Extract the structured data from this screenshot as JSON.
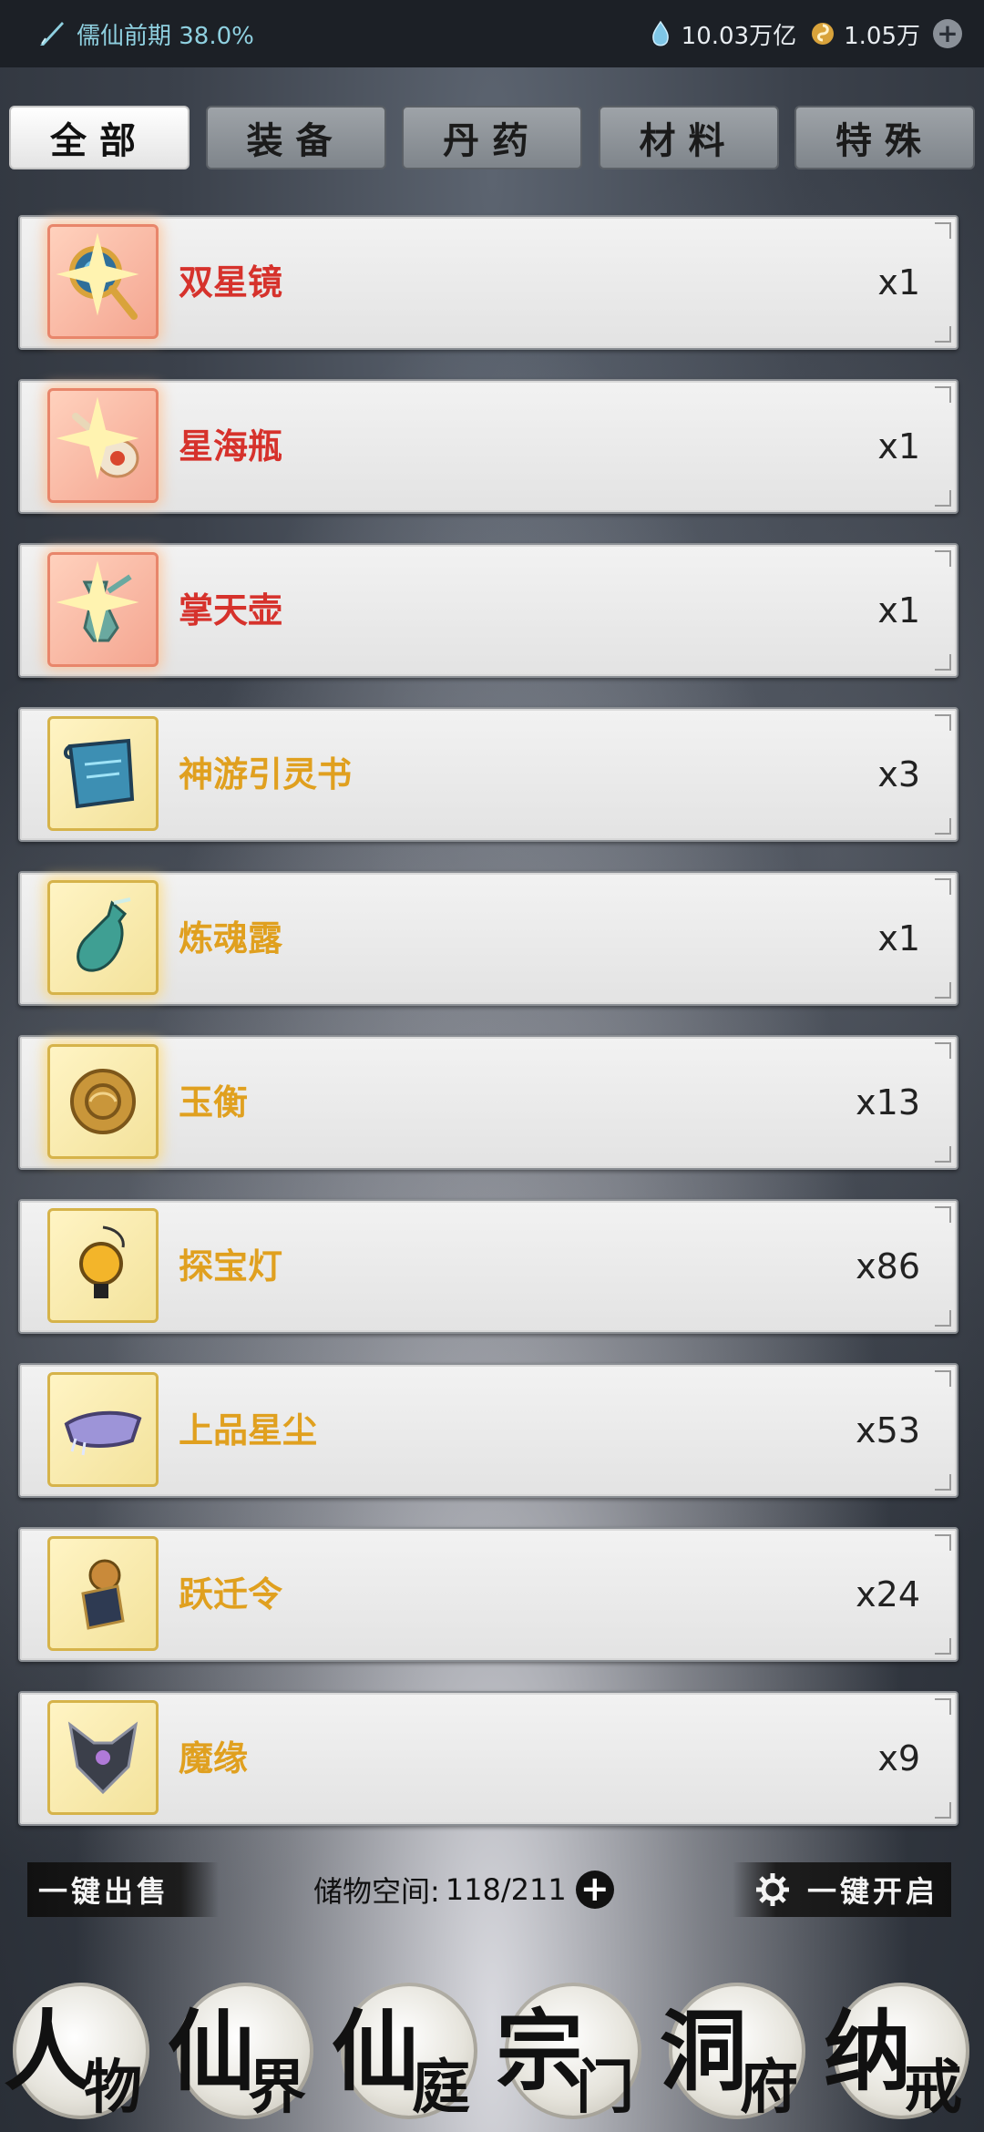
{
  "status": {
    "realm_label": "儒仙前期 38.0%",
    "spirit_stones": "10.03万亿",
    "currency2": "1.05万"
  },
  "tabs": [
    {
      "label": "全部",
      "active": true
    },
    {
      "label": "装备",
      "active": false
    },
    {
      "label": "丹药",
      "active": false
    },
    {
      "label": "材料",
      "active": false
    },
    {
      "label": "特殊",
      "active": false
    }
  ],
  "items": [
    {
      "name": "双星镜",
      "count": "x1",
      "rarity": "red",
      "icon": "mirror-icon"
    },
    {
      "name": "星海瓶",
      "count": "x1",
      "rarity": "red",
      "icon": "gourd-icon"
    },
    {
      "name": "掌天壶",
      "count": "x1",
      "rarity": "red",
      "icon": "vase-icon"
    },
    {
      "name": "神游引灵书",
      "count": "x3",
      "rarity": "gold",
      "icon": "scroll-icon"
    },
    {
      "name": "炼魂露",
      "count": "x1",
      "rarity": "gold",
      "icon": "bottle-icon"
    },
    {
      "name": "玉衡",
      "count": "x13",
      "rarity": "gold",
      "icon": "jade-disc-icon"
    },
    {
      "name": "探宝灯",
      "count": "x86",
      "rarity": "gold",
      "icon": "lantern-icon"
    },
    {
      "name": "上品星尘",
      "count": "x53",
      "rarity": "gold",
      "icon": "stardust-icon"
    },
    {
      "name": "跃迁令",
      "count": "x24",
      "rarity": "gold",
      "icon": "token-icon"
    },
    {
      "name": "魔缘",
      "count": "x9",
      "rarity": "gold",
      "icon": "demon-crest-icon"
    }
  ],
  "actions": {
    "sell_all": "一键出售",
    "storage_label": "储物空间:",
    "storage_value": "118/211",
    "open_all": "一键开启"
  },
  "nav": [
    {
      "big": "人",
      "small": "物"
    },
    {
      "big": "仙",
      "small": "界"
    },
    {
      "big": "仙",
      "small": "庭"
    },
    {
      "big": "宗",
      "small": "门"
    },
    {
      "big": "洞",
      "small": "府"
    },
    {
      "big": "纳",
      "small": "戒"
    }
  ],
  "colors": {
    "rarity_red": "#d6322c",
    "rarity_gold": "#e0a01f"
  }
}
